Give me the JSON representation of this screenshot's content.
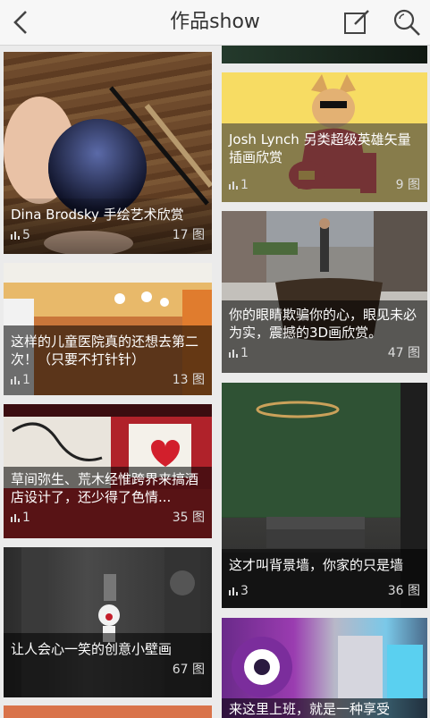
{
  "header": {
    "title": "作品show",
    "back_icon": "chevron-left-icon",
    "edit_icon": "edit-icon",
    "search_icon": "search-icon"
  },
  "left_column": [
    {
      "title": "Dina Brodsky 手绘艺术欣赏",
      "views": "5",
      "count": "17 图"
    },
    {
      "title": "这样的儿童医院真的还想去第二次！（只要不打针针）",
      "views": "1",
      "count": "13 图"
    },
    {
      "title": "草间弥生、荒木经惟跨界来搞酒店设计了，还少得了色情...",
      "views": "1",
      "count": "35 图"
    },
    {
      "title": "让人会心一笑的创意小壁画",
      "views": "",
      "count": "67 图"
    }
  ],
  "right_column": [
    {
      "title": "Josh Lynch 另类超级英雄矢量插画欣赏",
      "views": "1",
      "count": "9 图"
    },
    {
      "title": "你的眼睛欺骗你的心，眼见未必为实，震撼的3D画欣赏。",
      "views": "1",
      "count": "47 图"
    },
    {
      "title": "这才叫背景墙，你家的只是墙",
      "views": "3",
      "count": "36 图"
    },
    {
      "title": "来这里上班，就是一种享受",
      "views": "",
      "count": ""
    }
  ]
}
